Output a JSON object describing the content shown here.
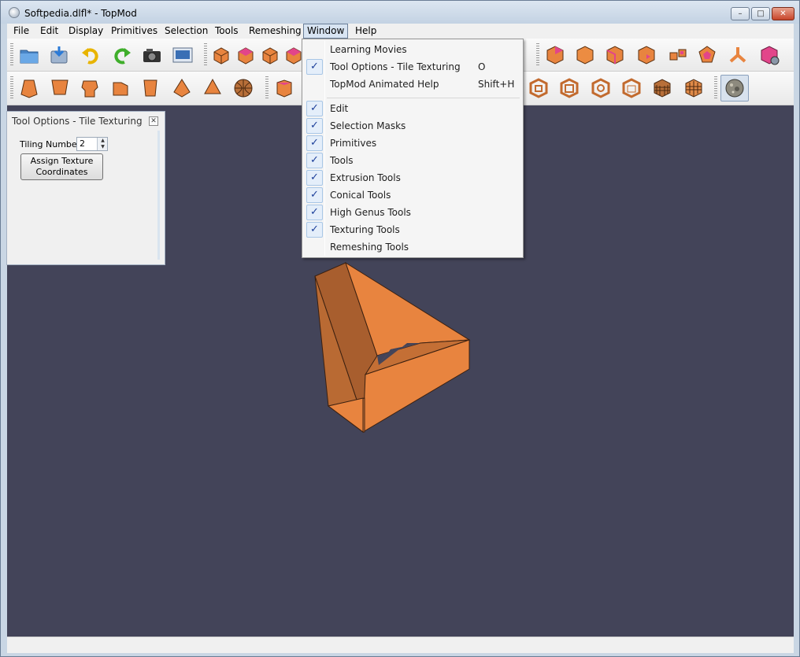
{
  "window": {
    "title": "Softpedia.dlfl* - TopMod",
    "minimize_glyph": "–",
    "maximize_glyph": "□",
    "close_glyph": "✕"
  },
  "menubar": {
    "items": [
      "File",
      "Edit",
      "Display",
      "Primitives",
      "Selection",
      "Tools",
      "Remeshing",
      "Window",
      "Help"
    ],
    "active": "Window"
  },
  "toolbar_icons": {
    "row1": [
      "open-folder-icon",
      "save-icon",
      "undo-icon",
      "redo-icon",
      "camera-icon",
      "screenshot-icon",
      "cube-icon",
      "cube-pink-face-icon",
      "cube-icon",
      "cube-pink-face-icon",
      "cube-pink-face-icon",
      "cube-icon",
      "cube-icon",
      "cube-icon",
      "split-cube-icon",
      "dodecahedron-icon",
      "tripod-icon",
      "cube-settings-icon"
    ],
    "row2": [
      "frustum-icon",
      "frustum-icon",
      "notched-cube-icon",
      "notched-cube-icon",
      "frustum-icon",
      "pyramid-icon",
      "pyramid-icon",
      "sphere-grid-icon",
      "cube-icon",
      "frame-cube-icon",
      "frame-cube-icon",
      "frame-cube-icon",
      "frame-cube-icon",
      "grid-cube-icon",
      "grid-cube-icon",
      "texture-sphere-icon"
    ]
  },
  "dock": {
    "title": "Tool Options - Tile Texturing",
    "tiling_label": "Tiling Number",
    "tiling_value": "2",
    "assign_button": "Assign Texture Coordinates"
  },
  "window_menu": {
    "items": [
      {
        "label": "Learning Movies",
        "checked": false,
        "shortcut": ""
      },
      {
        "label": "Tool Options - Tile Texturing",
        "checked": true,
        "shortcut": "O"
      },
      {
        "label": "TopMod Animated Help",
        "checked": false,
        "shortcut": "Shift+H"
      },
      {
        "label": "Edit",
        "checked": true,
        "shortcut": ""
      },
      {
        "label": "Selection Masks",
        "checked": true,
        "shortcut": ""
      },
      {
        "label": "Primitives",
        "checked": true,
        "shortcut": ""
      },
      {
        "label": "Tools",
        "checked": true,
        "shortcut": ""
      },
      {
        "label": "Extrusion Tools",
        "checked": true,
        "shortcut": ""
      },
      {
        "label": "Conical Tools",
        "checked": true,
        "shortcut": ""
      },
      {
        "label": "High Genus Tools",
        "checked": true,
        "shortcut": ""
      },
      {
        "label": "Texturing Tools",
        "checked": true,
        "shortcut": ""
      },
      {
        "label": "Remeshing Tools",
        "checked": false,
        "shortcut": ""
      }
    ],
    "check_glyph": "✓"
  },
  "colors": {
    "viewport_bg": "#434459",
    "model_orange": "#e8843f",
    "model_shadow": "#a85e2e",
    "pink": "#e2458a"
  }
}
